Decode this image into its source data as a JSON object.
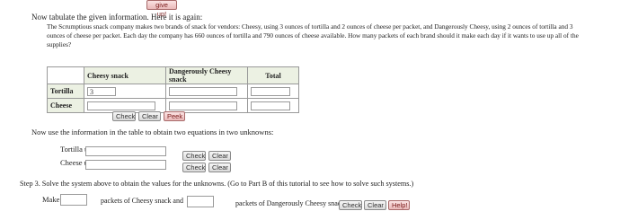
{
  "top_tab_label": "give up!",
  "intro": {
    "line1": "Now tabulate the given information. Here it is again:",
    "line2": "The Scrumptious snack company makes two brands of snack for vendors: Cheesy, using 3 ounces of tortilla and 2 ounces of cheese per packet, and Dangerously Cheesy, using 2 ounces of tortilla and 3",
    "line3": "ounces of cheese per packet. Each day the company has 660 ounces of tortilla and 790 ounces of cheese available. How many packets of each brand should it make each day if it wants to use up all of the",
    "line4": "supplies?"
  },
  "table": {
    "col_headers": [
      "Cheesy snack",
      "Dangerously Cheesy snack",
      "Total"
    ],
    "rows": [
      {
        "label": "Tortilla",
        "values": [
          "3",
          "",
          ""
        ]
      },
      {
        "label": "Cheese",
        "values": [
          "",
          "",
          ""
        ]
      }
    ]
  },
  "table_buttons": {
    "check": "Check",
    "clear": "Clear",
    "peek": "Peek"
  },
  "equations": {
    "instruction": "Now use the information in the table to obtain two equations in two unknowns:",
    "tortilla_label": "Tortilla usage:",
    "cheese_label": "Cheese usage:",
    "check": "Check",
    "clear": "Clear"
  },
  "step3": {
    "text": "Step 3. Solve the system above to obtain the values for the unknowns. (Go to Part B of this tutorial to see how to solve such systems.)",
    "make_label": "Make",
    "cheesy_label": "packets of Cheesy snack and",
    "dangerous_label": "packets of Dangerously Cheesy snack",
    "check": "Check",
    "clear": "Clear",
    "help": "Help!"
  }
}
